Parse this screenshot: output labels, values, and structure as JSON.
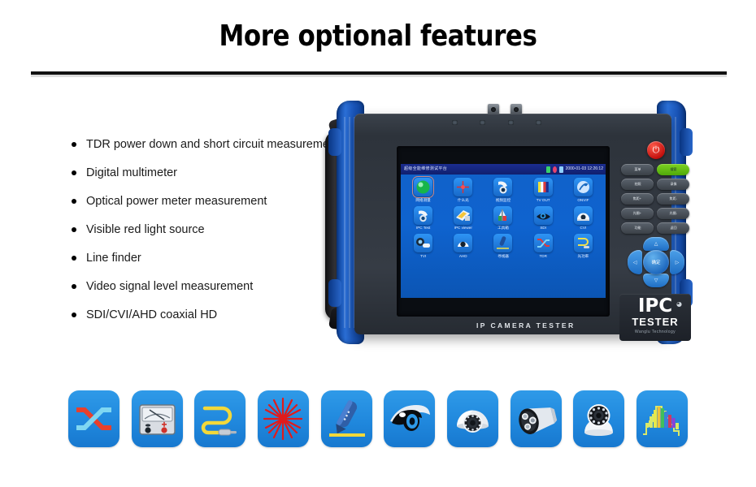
{
  "header": {
    "title": "More optional features"
  },
  "features": [
    {
      "text": "TDR power down and short circuit measurement"
    },
    {
      "text": " Digital multimeter"
    },
    {
      "text": "Optical power meter measurement"
    },
    {
      "text": "Visible red light source"
    },
    {
      "text": " Line finder"
    },
    {
      "text": "Video signal level measurement"
    },
    {
      "text": "SDI/CVI/AHD coaxial HD"
    }
  ],
  "device": {
    "bezel_branding": "IP  CAMERA  TESTER",
    "brand": {
      "name": "IPC",
      "wifi_icon": "wifi-icon",
      "product": "TESTER",
      "company": "Wanglu Technology"
    },
    "power_button": {
      "name": "power-button",
      "glyph": "⏻",
      "color": "#c4110e"
    },
    "screen": {
      "status_bar": {
        "title": "超级全能维修测试平台",
        "battery_icon": "battery-icon",
        "network_icon": "network-icon",
        "signal_icon": "signal-icon",
        "clock": "2000-01-03 12:26:12"
      },
      "apps": [
        {
          "label": "网络测量",
          "icon": "green-sphere-icon",
          "selected": true
        },
        {
          "label": "什么光",
          "icon": "red-crosshair-icon",
          "selected": false
        },
        {
          "label": "视频监控",
          "icon": "ptz-dome-icon",
          "selected": false
        },
        {
          "label": "TV OUT",
          "icon": "color-bars-icon",
          "selected": false
        },
        {
          "label": "ONVIF",
          "icon": "onvif-icon",
          "selected": false
        },
        {
          "label": "IPC Test",
          "icon": "ipc-test-icon",
          "selected": false
        },
        {
          "label": "IPC viewer",
          "icon": "ipc-viewer-icon",
          "selected": false
        },
        {
          "label": "工具箱",
          "icon": "toolbox-icon",
          "selected": false
        },
        {
          "label": "SDI",
          "icon": "sdi-eye-icon",
          "selected": false
        },
        {
          "label": "CVI",
          "icon": "cvi-dome-icon",
          "selected": false
        },
        {
          "label": "TVI",
          "icon": "tvi-camera-icon",
          "selected": false
        },
        {
          "label": "AHD",
          "icon": "ahd-dome-icon",
          "selected": false
        },
        {
          "label": "寻线器",
          "icon": "line-finder-icon",
          "selected": false
        },
        {
          "label": "TDR",
          "icon": "tdr-icon",
          "selected": false
        },
        {
          "label": "光功率",
          "icon": "optical-power-icon",
          "selected": false
        }
      ],
      "led_indicators": [
        "led-1",
        "led-2",
        "led-3",
        "led-4"
      ]
    },
    "keypad": [
      {
        "label": "菜单",
        "name": "menu-key",
        "accent": false
      },
      {
        "label": "搜索",
        "name": "search-key",
        "accent": true
      },
      {
        "label": "拍照",
        "name": "capture-key",
        "accent": false
      },
      {
        "label": "录像",
        "name": "record-key",
        "accent": false
      },
      {
        "label": "焦距+",
        "name": "zoom-in-key",
        "accent": false
      },
      {
        "label": "焦距-",
        "name": "zoom-out-key",
        "accent": false
      },
      {
        "label": "光圈+",
        "name": "iris-open-key",
        "accent": false
      },
      {
        "label": "光圈-",
        "name": "iris-close-key",
        "accent": false
      },
      {
        "label": "功能",
        "name": "function-key",
        "accent": false
      },
      {
        "label": "返回",
        "name": "back-key",
        "accent": false
      }
    ],
    "dpad": {
      "up": "△",
      "down": "▽",
      "left": "◁",
      "right": "▷",
      "center": "确定"
    },
    "connectors": [
      "bnc-connector-1",
      "bnc-connector-2"
    ],
    "hand_strap": "hand-strap"
  },
  "feature_icons": [
    {
      "name": "tdr-icon",
      "label": "TDR power down and short circuit"
    },
    {
      "name": "multimeter-icon",
      "label": "Digital multimeter"
    },
    {
      "name": "optical-power-meter-icon",
      "label": "Optical power meter"
    },
    {
      "name": "red-laser-source-icon",
      "label": "Visible red light source"
    },
    {
      "name": "line-finder-icon",
      "label": "Line finder"
    },
    {
      "name": "eye-dome-camera-icon",
      "label": "Video signal level"
    },
    {
      "name": "turret-dome-camera-icon",
      "label": "Dome camera"
    },
    {
      "name": "bullet-camera-icon",
      "label": "Bullet camera"
    },
    {
      "name": "ir-dome-camera-icon",
      "label": "IR dome camera"
    },
    {
      "name": "signal-level-chart-icon",
      "label": "Video signal level measurement"
    }
  ],
  "colors": {
    "icon_blue": "#2088dd",
    "device_blue": "#1257c4",
    "screen_blue": "#0f63cf",
    "power_red": "#c4110e",
    "accent_green": "#7ed321"
  }
}
